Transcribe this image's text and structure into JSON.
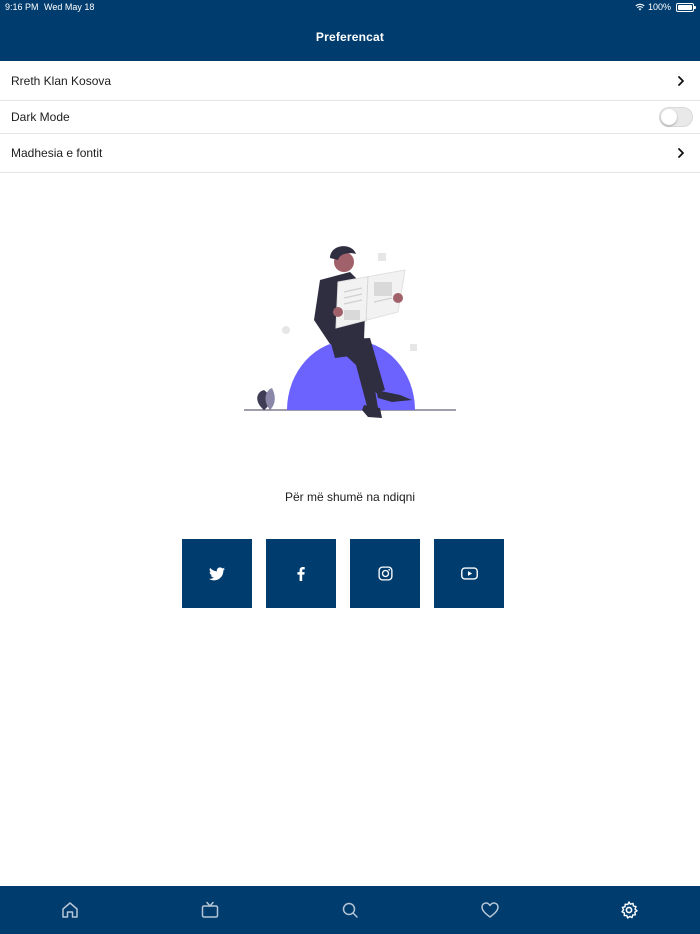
{
  "status_bar": {
    "time": "9:16 PM",
    "date": "Wed May 18",
    "battery": "100%"
  },
  "header": {
    "title": "Preferencat"
  },
  "menu": {
    "items": [
      {
        "label": "Rreth Klan Kosova",
        "icon": "chevron-right-icon"
      },
      {
        "label": "Dark Mode",
        "toggle": false
      },
      {
        "label": "Madhesia e fontit",
        "icon": "chevron-right-icon"
      }
    ]
  },
  "follow": {
    "text": "Për më shumë na ndiqni"
  },
  "social": [
    {
      "icon": "twitter-icon"
    },
    {
      "icon": "facebook-icon"
    },
    {
      "icon": "instagram-icon"
    },
    {
      "icon": "youtube-icon"
    }
  ],
  "tabbar": {
    "items": [
      {
        "icon": "home-icon"
      },
      {
        "icon": "tv-icon"
      },
      {
        "icon": "search-icon"
      },
      {
        "icon": "heart-icon"
      },
      {
        "icon": "gear-icon",
        "active": true
      }
    ]
  },
  "colors": {
    "primary": "#003c6e",
    "accent": "#6c63ff",
    "text": "#1d1d1f"
  }
}
